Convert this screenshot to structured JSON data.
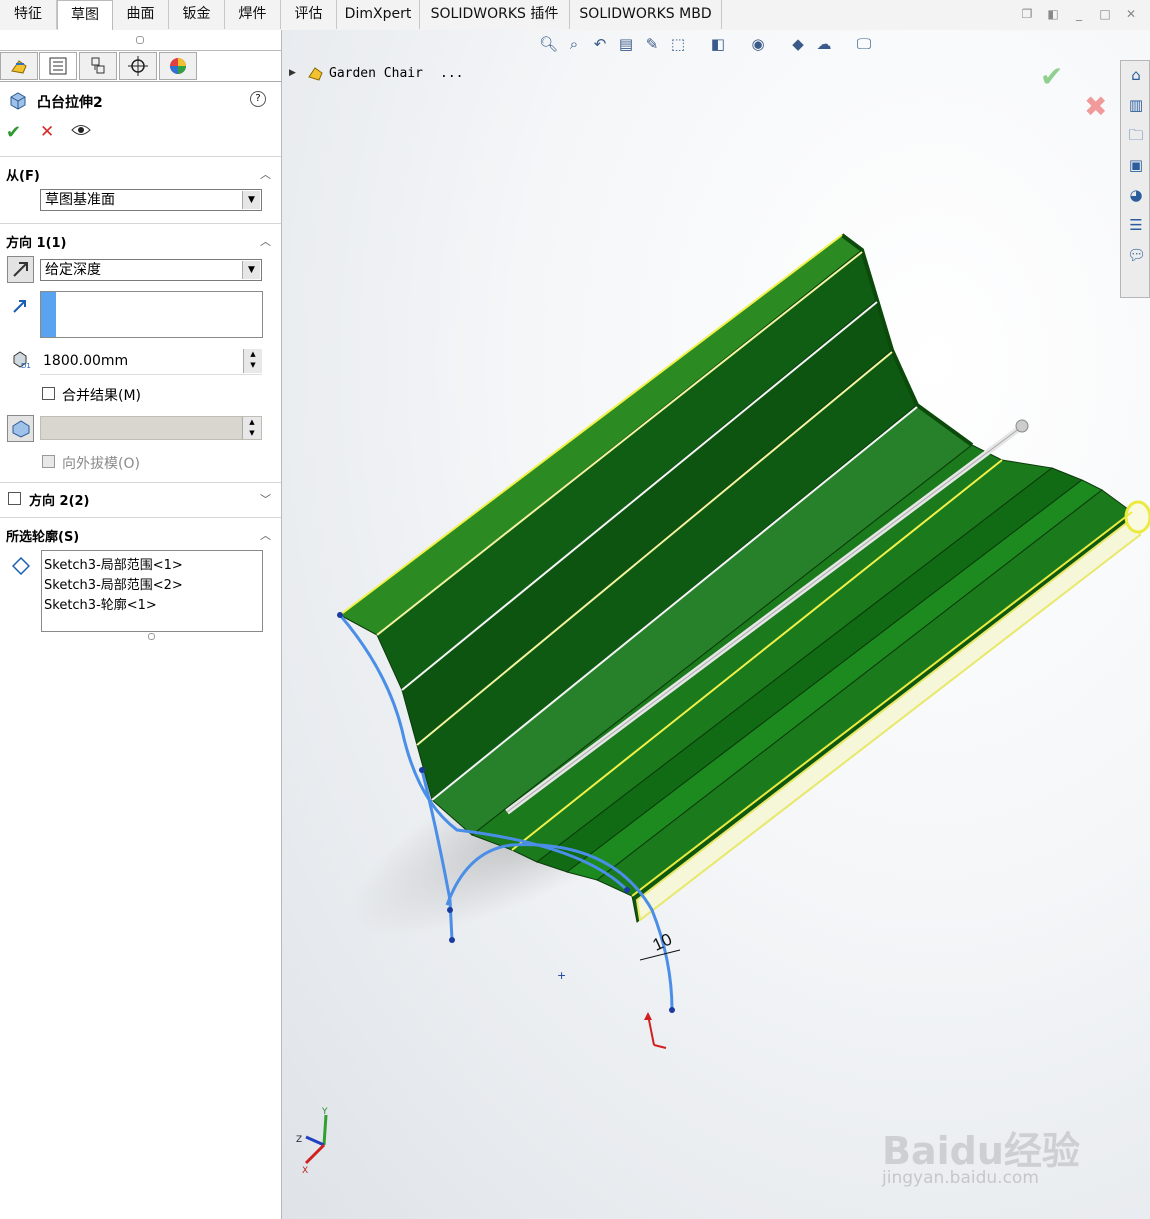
{
  "tabs": [
    "特征",
    "草图",
    "曲面",
    "钣金",
    "焊件",
    "评估",
    "DimXpert",
    "SOLIDWORKS 插件",
    "SOLIDWORKS MBD"
  ],
  "active_tab": "草图",
  "window_buttons": [
    "restore-icon",
    "split-icon",
    "minimize-icon",
    "maximize-icon",
    "close-icon"
  ],
  "property_manager": {
    "title": "凸台拉伸2",
    "help_icon": "?",
    "from": {
      "label": "从(F)",
      "value": "草图基准面"
    },
    "direction1": {
      "label": "方向 1(1)",
      "end_condition": "给定深度",
      "depth": "1800.00mm",
      "merge_label": "合并结果(M)",
      "merge_checked": false,
      "draft_label": "向外拔模(O)"
    },
    "direction2": {
      "label": "方向 2(2)",
      "checked": false
    },
    "selected_contours": {
      "label": "所选轮廓(S)",
      "items": [
        "Sketch3-局部范围<1>",
        "Sketch3-局部范围<2>",
        "Sketch3-轮廓<1>"
      ]
    }
  },
  "feature_tree": {
    "root_label": "Garden Chair",
    "ellipsis": "..."
  },
  "dimension_label": "10",
  "axes": {
    "x": "X",
    "y": "Y",
    "z": "Z"
  },
  "watermark": {
    "logo": "Baidu经验",
    "url": "jingyan.baidu.com"
  },
  "colors": {
    "slat_green": "#1f7a1a",
    "slat_dark": "#0b4a0b",
    "highlight_yellow": "#f2f24a",
    "sketch_blue": "#4a8ee8",
    "confirm_green": "#2e9a2e",
    "cancel_red": "#d62b2b"
  }
}
